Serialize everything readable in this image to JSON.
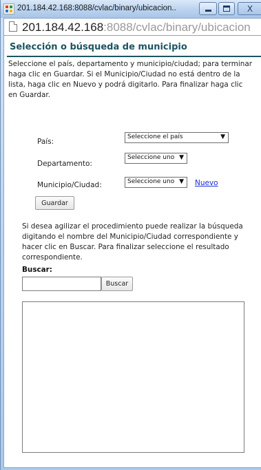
{
  "window": {
    "title": "201.184.42.168:8088/cvlac/binary/ubicacion....",
    "url_host": "201.184.42.168",
    "url_rest": ":8088/cvlac/binary/ubicacion"
  },
  "page": {
    "heading": "Selección o búsqueda de municipio",
    "intro": "Seleccione el país, departamento y municipio/ciudad; para terminar haga clic en Guardar. Si el Municipio/Ciudad no está dentro de la lista, haga clic en Nuevo y podrá digitarlo. Para finalizar haga clic en Guardar."
  },
  "form": {
    "pais_label": "País:",
    "pais_value": "Seleccione el país",
    "depto_label": "Departamento:",
    "depto_value": "Seleccione uno",
    "municipio_label": "Municipio/Ciudad:",
    "municipio_value": "Seleccione uno",
    "nuevo_link": "Nuevo",
    "guardar_button": "Guardar"
  },
  "search": {
    "help": "Si desea agilizar el procedimiento puede realizar la búsqueda digitando el nombre del Municipio/Ciudad correspondiente y hacer clic en Buscar. Para finalizar seleccione el resultado correspondiente.",
    "label": "Buscar:",
    "input_value": "",
    "button": "Buscar"
  },
  "icons": {
    "dropdown": "▼"
  }
}
